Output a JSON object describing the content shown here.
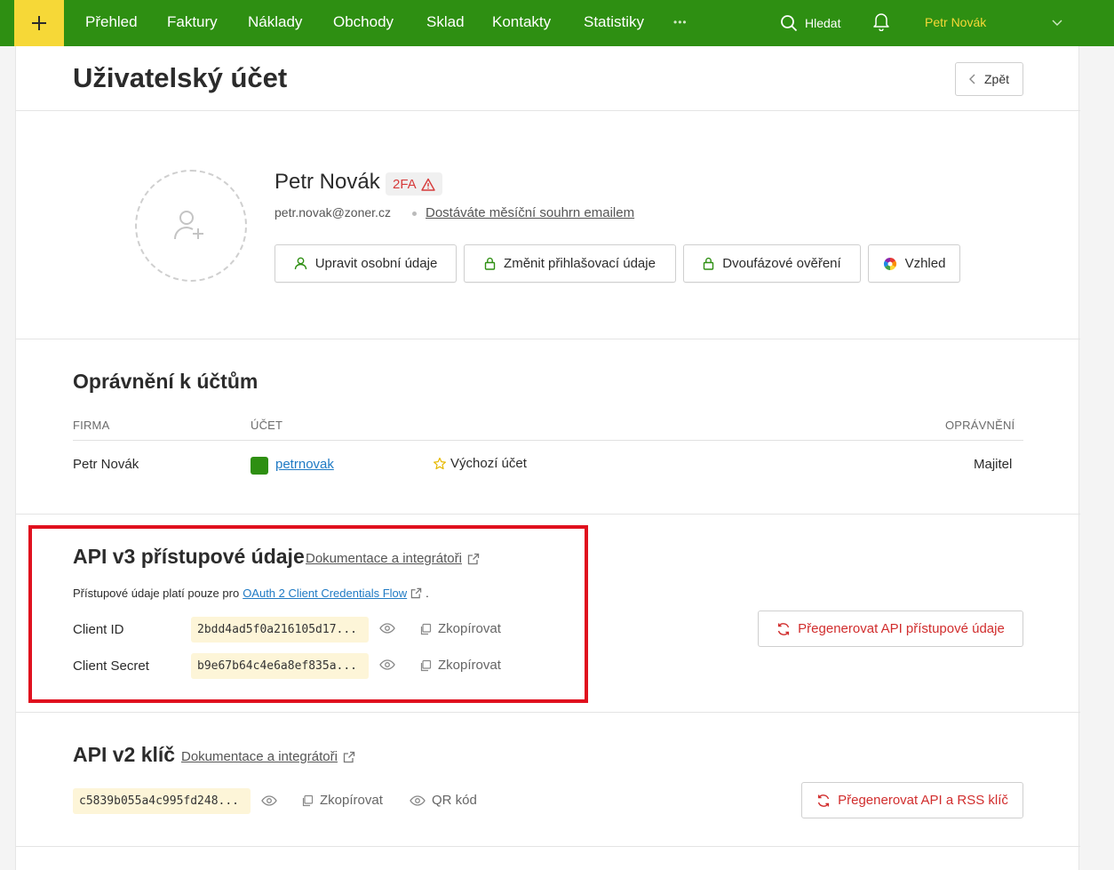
{
  "nav": {
    "items": [
      "Přehled",
      "Faktury",
      "Náklady",
      "Obchody",
      "Sklad",
      "Kontakty",
      "Statistiky"
    ],
    "more": "•••",
    "search_label": "Hledat",
    "user_name": "Petr Novák"
  },
  "page": {
    "title": "Uživatelský účet",
    "back_label": "Zpět"
  },
  "profile": {
    "name": "Petr Novák",
    "badge": "2FA",
    "email": "petr.novak@zoner.cz",
    "summary_link": "Dostáváte měsíční souhrn emailem",
    "buttons": {
      "edit_personal": "Upravit osobní údaje",
      "change_login": "Změnit přihlašovací údaje",
      "two_factor": "Dvoufázové ověření",
      "appearance": "Vzhled"
    }
  },
  "permissions": {
    "title": "Oprávnění k účtům",
    "headers": {
      "firm": "FIRMA",
      "account": "ÚČET",
      "permission": "OPRÁVNĚNÍ"
    },
    "rows": [
      {
        "firm": "Petr Novák",
        "account": "petrnovak",
        "default_label": "Výchozí účet",
        "permission": "Majitel"
      }
    ]
  },
  "api_v3": {
    "title": "API v3 přístupové údaje",
    "doc_link": "Dokumentace a integrátoři",
    "note_prefix": "Přístupové údaje platí pouze pro",
    "note_link": "OAuth 2 Client Credentials Flow",
    "note_suffix": ".",
    "client_id_label": "Client ID",
    "client_id_value": "2bdd4ad5f0a216105d17...",
    "client_secret_label": "Client Secret",
    "client_secret_value": "b9e67b64c4e6a8ef835a...",
    "copy_label": "Zkopírovat",
    "regenerate_label": "Přegenerovat API přístupové údaje"
  },
  "api_v2": {
    "title": "API v2 klíč",
    "doc_link": "Dokumentace a integrátoři",
    "key_value": "c5839b055a4c995fd248...",
    "copy_label": "Zkopírovat",
    "qr_label": "QR kód",
    "regenerate_label": "Přegenerovat API a RSS klíč"
  },
  "colors": {
    "nav_green": "#2e8f12",
    "accent_yellow": "#f6d837",
    "danger_red": "#d12d2d",
    "highlight_red": "#e0101e",
    "link_blue": "#1f7ac4"
  }
}
